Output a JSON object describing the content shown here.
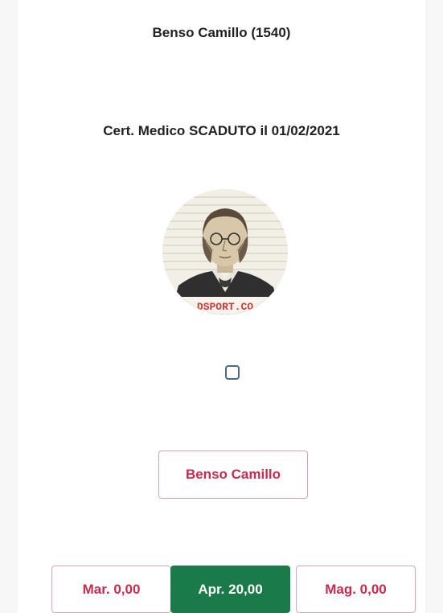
{
  "header": {
    "title": "Benso Camillo (1540)"
  },
  "certificate": {
    "status_text": "Cert. Medico SCADUTO il 01/02/2021"
  },
  "avatar": {
    "watermark_text": "DSPORT.CO"
  },
  "selection": {
    "checked": false
  },
  "person_button": {
    "label": "Benso Camillo"
  },
  "months": [
    {
      "label": "Mar. 0,00",
      "active": false
    },
    {
      "label": "Apr. 20,00",
      "active": true
    },
    {
      "label": "Mag. 0,00",
      "active": false
    }
  ],
  "colors": {
    "accent_red": "#c92a4e",
    "active_green": "#1b7a4a",
    "outline_border": "#d9a5b0",
    "checkbox_border": "#4a6a8a"
  }
}
